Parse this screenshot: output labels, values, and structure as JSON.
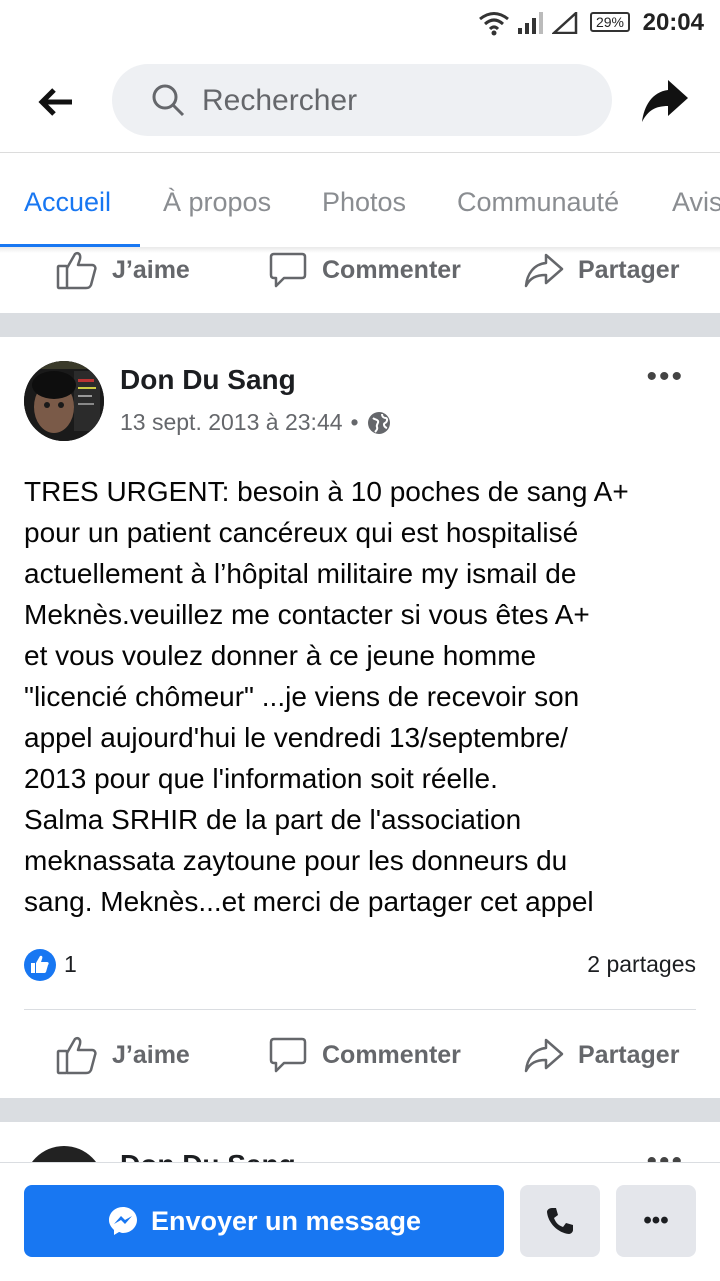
{
  "status_bar": {
    "battery": "29%",
    "time": "20:04"
  },
  "search": {
    "placeholder": "Rechercher"
  },
  "tabs": [
    {
      "label": "Accueil",
      "active": true
    },
    {
      "label": "À propos"
    },
    {
      "label": "Photos"
    },
    {
      "label": "Communauté"
    },
    {
      "label": "Avis"
    }
  ],
  "actions": {
    "like": "J’aime",
    "comment": "Commenter",
    "share": "Partager"
  },
  "post": {
    "author": "Don Du Sang",
    "date": "13 sept. 2013 à 23:44",
    "dot": "•",
    "text_lines": [
      "TRES URGENT: besoin à 10 poches de sang A+",
      "pour un patient cancéreux qui est hospitalisé",
      "actuellement à l’hôpital militaire my ismail de",
      "Meknès.veuillez me contacter si vous êtes A+",
      "et vous voulez donner à ce jeune homme",
      "\"licencié chômeur\" ...je viens de recevoir son",
      "appel aujourd'hui le vendredi 13/septembre/",
      "2013 pour que l'information soit réelle.",
      "Salma SRHIR de la part de l'association",
      "meknassata zaytoune pour les donneurs du",
      "sang. Meknès...et merci de partager cet appel"
    ],
    "like_count": "1",
    "shares": "2 partages",
    "more": "•••"
  },
  "next_post": {
    "author": "Don Du Sang",
    "more": "•••"
  },
  "bottom_bar": {
    "message_label": "Envoyer un message",
    "more": "•••"
  },
  "colors": {
    "accent": "#1877f2",
    "separator": "#dadde1",
    "muted": "#65676b"
  }
}
